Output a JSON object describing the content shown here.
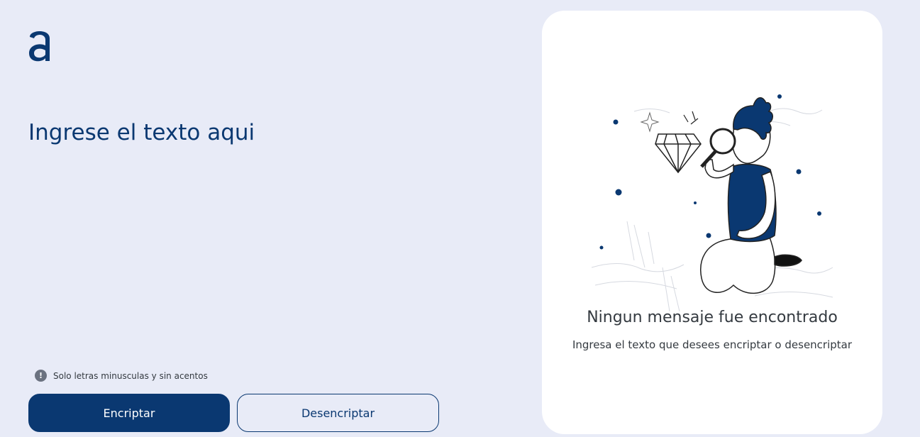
{
  "brand": {
    "logo_icon": "alura-a-logo-icon",
    "primary_color": "#0A3871",
    "background_color": "#E8EBF7"
  },
  "input": {
    "placeholder": "Ingrese el texto aqui",
    "value": ""
  },
  "hint": {
    "icon": "exclamation-circle-icon",
    "text": "Solo letras minusculas y sin acentos"
  },
  "actions": {
    "encrypt_label": "Encriptar",
    "decrypt_label": "Desencriptar"
  },
  "output": {
    "illustration": "boy-with-magnifying-glass-and-diamond-illustration",
    "empty_title": "Ningun mensaje fue encontrado",
    "empty_subtitle": "Ingresa el texto que desees encriptar o desencriptar"
  }
}
